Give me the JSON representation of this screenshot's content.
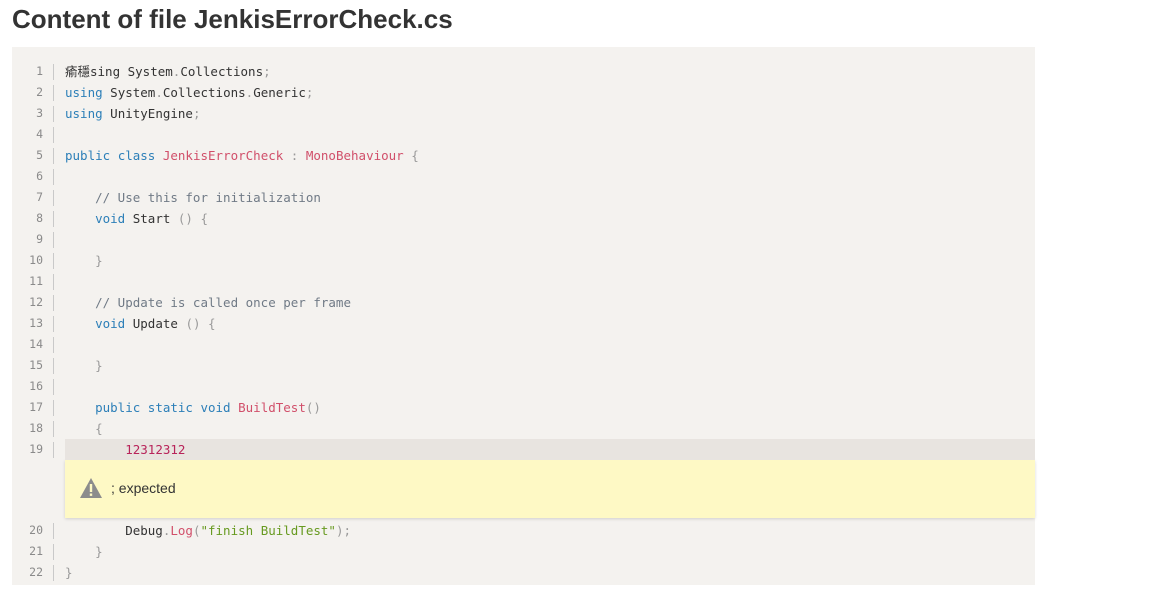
{
  "page": {
    "title": "Content of file JenkisErrorCheck.cs"
  },
  "error": {
    "message": "; expected",
    "icon": "warning-icon"
  },
  "colors": {
    "keyword": "#2c7fb8",
    "type_name": "#d14f6a",
    "comment": "#707a86",
    "string": "#679a20",
    "number": "#b8245a",
    "panel_background": "#f4f2ef",
    "error_background": "#fef9c5"
  },
  "code": {
    "lines": [
      {
        "number": "1",
        "tokens": [
          {
            "t": "瘉穩sing System",
            "c": "plain"
          },
          {
            "t": ".",
            "c": "punct"
          },
          {
            "t": "Collections",
            "c": "plain"
          },
          {
            "t": ";",
            "c": "punct"
          }
        ]
      },
      {
        "number": "2",
        "tokens": [
          {
            "t": "using",
            "c": "kw"
          },
          {
            "t": " System",
            "c": "plain"
          },
          {
            "t": ".",
            "c": "punct"
          },
          {
            "t": "Collections",
            "c": "plain"
          },
          {
            "t": ".",
            "c": "punct"
          },
          {
            "t": "Generic",
            "c": "plain"
          },
          {
            "t": ";",
            "c": "punct"
          }
        ]
      },
      {
        "number": "3",
        "tokens": [
          {
            "t": "using",
            "c": "kw"
          },
          {
            "t": " UnityEngine",
            "c": "plain"
          },
          {
            "t": ";",
            "c": "punct"
          }
        ]
      },
      {
        "number": "4",
        "tokens": []
      },
      {
        "number": "5",
        "tokens": [
          {
            "t": "public",
            "c": "kw"
          },
          {
            "t": " ",
            "c": "plain"
          },
          {
            "t": "class",
            "c": "kw"
          },
          {
            "t": " ",
            "c": "plain"
          },
          {
            "t": "JenkisErrorCheck",
            "c": "type"
          },
          {
            "t": " : ",
            "c": "punct"
          },
          {
            "t": "MonoBehaviour",
            "c": "type"
          },
          {
            "t": " {",
            "c": "punct"
          }
        ]
      },
      {
        "number": "6",
        "tokens": []
      },
      {
        "number": "7",
        "tokens": [
          {
            "t": "    // Use this for initialization",
            "c": "comment"
          }
        ]
      },
      {
        "number": "8",
        "tokens": [
          {
            "t": "    ",
            "c": "plain"
          },
          {
            "t": "void",
            "c": "kw"
          },
          {
            "t": " Start ",
            "c": "plain"
          },
          {
            "t": "() {",
            "c": "punct"
          }
        ]
      },
      {
        "number": "9",
        "tokens": []
      },
      {
        "number": "10",
        "tokens": [
          {
            "t": "    }",
            "c": "punct"
          }
        ]
      },
      {
        "number": "11",
        "tokens": []
      },
      {
        "number": "12",
        "tokens": [
          {
            "t": "    // Update is called once per frame",
            "c": "comment"
          }
        ]
      },
      {
        "number": "13",
        "tokens": [
          {
            "t": "    ",
            "c": "plain"
          },
          {
            "t": "void",
            "c": "kw"
          },
          {
            "t": " Update ",
            "c": "plain"
          },
          {
            "t": "() {",
            "c": "punct"
          }
        ]
      },
      {
        "number": "14",
        "tokens": []
      },
      {
        "number": "15",
        "tokens": [
          {
            "t": "    }",
            "c": "punct"
          }
        ]
      },
      {
        "number": "16",
        "tokens": []
      },
      {
        "number": "17",
        "tokens": [
          {
            "t": "    ",
            "c": "plain"
          },
          {
            "t": "public",
            "c": "kw"
          },
          {
            "t": " ",
            "c": "plain"
          },
          {
            "t": "static",
            "c": "kw"
          },
          {
            "t": " ",
            "c": "plain"
          },
          {
            "t": "void",
            "c": "kw"
          },
          {
            "t": " ",
            "c": "plain"
          },
          {
            "t": "BuildTest",
            "c": "fn"
          },
          {
            "t": "()",
            "c": "punct"
          }
        ]
      },
      {
        "number": "18",
        "tokens": [
          {
            "t": "    {",
            "c": "punct"
          }
        ]
      },
      {
        "number": "19",
        "error": true,
        "tokens": [
          {
            "t": "        ",
            "c": "plain"
          },
          {
            "t": "12312312",
            "c": "num"
          }
        ]
      },
      {
        "number": "20",
        "tokens": [
          {
            "t": "        Debug",
            "c": "plain"
          },
          {
            "t": ".",
            "c": "punct"
          },
          {
            "t": "Log",
            "c": "fn"
          },
          {
            "t": "(",
            "c": "punct"
          },
          {
            "t": "\"finish BuildTest\"",
            "c": "str"
          },
          {
            "t": ");",
            "c": "punct"
          }
        ]
      },
      {
        "number": "21",
        "tokens": [
          {
            "t": "    }",
            "c": "punct"
          }
        ]
      },
      {
        "number": "22",
        "tokens": [
          {
            "t": "}",
            "c": "punct"
          }
        ]
      }
    ]
  }
}
